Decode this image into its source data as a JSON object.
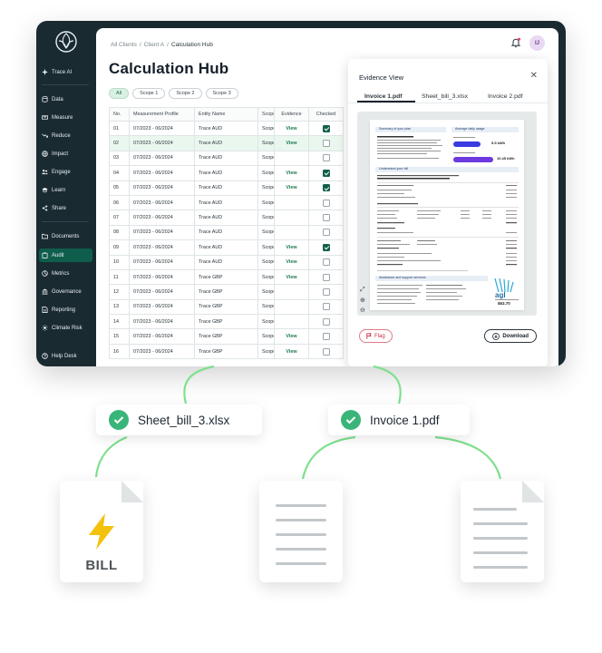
{
  "sidebar": {
    "items": [
      {
        "label": "Trace AI",
        "icon": "sparkle-icon"
      },
      {
        "label": "Data",
        "icon": "database-icon"
      },
      {
        "label": "Measure",
        "icon": "measure-icon"
      },
      {
        "label": "Reduce",
        "icon": "trend-down-icon"
      },
      {
        "label": "Impact",
        "icon": "globe-icon"
      },
      {
        "label": "Engage",
        "icon": "engage-icon"
      },
      {
        "label": "Learn",
        "icon": "learn-icon"
      },
      {
        "label": "Share",
        "icon": "share-icon"
      },
      {
        "label": "Documents",
        "icon": "folder-icon"
      },
      {
        "label": "Audit",
        "icon": "clipboard-icon",
        "active": true
      },
      {
        "label": "Metrics",
        "icon": "metrics-icon"
      },
      {
        "label": "Governance",
        "icon": "bank-icon"
      },
      {
        "label": "Reporting",
        "icon": "report-icon"
      },
      {
        "label": "Climate Risk",
        "icon": "sun-icon"
      },
      {
        "label": "Help Desk",
        "icon": "help-icon"
      }
    ]
  },
  "header": {
    "breadcrumb": [
      "All Clients",
      "Client A",
      "Calculation Hub"
    ],
    "title": "Calculation Hub",
    "avatar_initials": "IJ"
  },
  "filters": [
    "All",
    "Scope 1",
    "Scope 2",
    "Scope 3"
  ],
  "table": {
    "columns": [
      "No.",
      "Measurement Profile",
      "Entity Name",
      "Scope",
      "Evidence",
      "Checked"
    ],
    "rows": [
      {
        "no": "01",
        "profile": "07/2023 - 06/2024",
        "entity": "Trace AUD",
        "scope": "Scope",
        "evidence": "View",
        "checked": true
      },
      {
        "no": "02",
        "profile": "07/2023 - 06/2024",
        "entity": "Trace AUD",
        "scope": "Scope",
        "evidence": "View",
        "checked": false
      },
      {
        "no": "03",
        "profile": "07/2023 - 06/2024",
        "entity": "Trace AUD",
        "scope": "Scope",
        "evidence": "",
        "checked": false
      },
      {
        "no": "04",
        "profile": "07/2023 - 06/2024",
        "entity": "Trace AUD",
        "scope": "Scope",
        "evidence": "View",
        "checked": true
      },
      {
        "no": "05",
        "profile": "07/2023 - 06/2024",
        "entity": "Trace AUD",
        "scope": "Scope",
        "evidence": "View",
        "checked": true
      },
      {
        "no": "06",
        "profile": "07/2023 - 06/2024",
        "entity": "Trace AUD",
        "scope": "Scope",
        "evidence": "",
        "checked": false
      },
      {
        "no": "07",
        "profile": "07/2023 - 06/2024",
        "entity": "Trace AUD",
        "scope": "Scope",
        "evidence": "",
        "checked": false
      },
      {
        "no": "08",
        "profile": "07/2023 - 06/2024",
        "entity": "Trace AUD",
        "scope": "Scope",
        "evidence": "",
        "checked": false
      },
      {
        "no": "09",
        "profile": "07/2023 - 06/2024",
        "entity": "Trace AUD",
        "scope": "Scope",
        "evidence": "View",
        "checked": true
      },
      {
        "no": "10",
        "profile": "07/2023 - 06/2024",
        "entity": "Trace AUD",
        "scope": "Scope",
        "evidence": "View",
        "checked": false
      },
      {
        "no": "11",
        "profile": "07/2023 - 06/2024",
        "entity": "Trace GBP",
        "scope": "Scope",
        "evidence": "View",
        "checked": false
      },
      {
        "no": "12",
        "profile": "07/2023 - 06/2024",
        "entity": "Trace GBP",
        "scope": "Scope",
        "evidence": "",
        "checked": false
      },
      {
        "no": "13",
        "profile": "07/2023 - 06/2024",
        "entity": "Trace GBP",
        "scope": "Scope",
        "evidence": "",
        "checked": false
      },
      {
        "no": "14",
        "profile": "07/2023 - 06/2024",
        "entity": "Trace GBP",
        "scope": "Scope",
        "evidence": "",
        "checked": false
      },
      {
        "no": "15",
        "profile": "07/2023 - 06/2024",
        "entity": "Trace GBP",
        "scope": "Scope",
        "evidence": "View",
        "checked": false
      },
      {
        "no": "16",
        "profile": "07/2023 - 06/2024",
        "entity": "Trace GBP",
        "scope": "Scope",
        "evidence": "View",
        "checked": false
      }
    ]
  },
  "evidence": {
    "title": "Evidence View",
    "tabs": [
      "Invoice 1.pdf",
      "Sheet_bill_3.xlsx",
      "Invoice 2.pdf"
    ],
    "flag_label": "Flag",
    "download_label": "Download",
    "invoice": {
      "brand": "agl",
      "section_summary": "Summary of your plan",
      "section_usage": "Average daily usage",
      "section_understand": "Understand your bill",
      "section_assist": "Assistance and support services",
      "usage_values": [
        "5.5 kWh",
        "10.45 kWh"
      ],
      "amount": "$63.70"
    }
  },
  "graphic": {
    "badges": [
      "Sheet_bill_3.xlsx",
      "Invoice 1.pdf"
    ],
    "bill_label": "BILL"
  },
  "colors": {
    "sidebar_bg": "#1a2a31",
    "accent_green": "#14604a",
    "check_green": "#3ab57a",
    "connector_green": "#7fe08e",
    "flag_red": "#c8323f",
    "bolt_yellow": "#f4c20d"
  }
}
